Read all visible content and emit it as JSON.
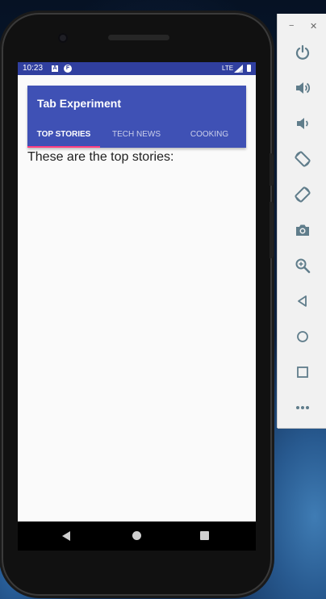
{
  "status_bar": {
    "time": "10:23",
    "notification_icons": [
      "a-icon",
      "f-icon"
    ],
    "network": "LTE"
  },
  "app": {
    "title": "Tab Experiment",
    "tabs": [
      {
        "label": "TOP STORIES",
        "selected": true
      },
      {
        "label": "TECH NEWS",
        "selected": false
      },
      {
        "label": "COOKING",
        "selected": false
      }
    ],
    "content_text": "These are the top stories:"
  },
  "emulator_toolbar": {
    "window_buttons": [
      "minimize-icon",
      "close-icon"
    ],
    "buttons": [
      "power-icon",
      "volume-up-icon",
      "volume-down-icon",
      "rotate-left-icon",
      "rotate-right-icon",
      "camera-icon",
      "zoom-icon",
      "back-icon",
      "home-icon",
      "overview-icon",
      "more-icon"
    ]
  },
  "nav_bar": {
    "buttons": [
      "back-icon",
      "home-icon",
      "recent-apps-icon"
    ]
  },
  "colors": {
    "status_bar": "#303f9f",
    "app_bar": "#3f51b5",
    "tab_indicator": "#ff4081",
    "screen_background": "#fafafa",
    "toolbar_icon": "#607d8b"
  }
}
